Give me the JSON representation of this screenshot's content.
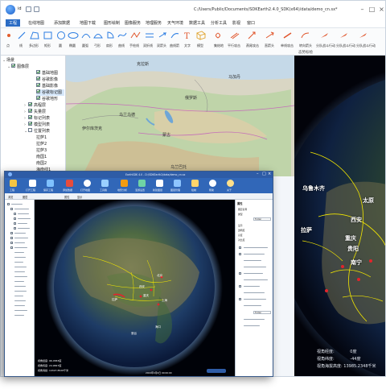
{
  "back_window": {
    "app_name": "id",
    "title": "C:/Users/Public/Documents/SDKEarth2.4.0_SDK(x64)/data/demo_cn.sx*",
    "menus": [
      "工程",
      "在线地图",
      "添加数据",
      "地图下载",
      "图形绘制",
      "图像服务",
      "地理服务",
      "天气环境",
      "数据工具",
      "分析工具",
      "影视",
      "窗口"
    ],
    "active_menu": "工程",
    "ribbon_tools": [
      "点",
      "线",
      "多边形",
      "矩形",
      "圆",
      "椭圆",
      "圆弧",
      "弓形",
      "扇形",
      "曲线",
      "手绘线",
      "双折线",
      "双箭头",
      "曲线箭",
      "文字",
      "模型"
    ],
    "ribbon_right_tools": [
      "集结地",
      "平行攻击",
      "燕尾攻击",
      "直箭头",
      "单线攻击",
      "转向箭头",
      "分队战斗行动",
      "分队战斗行动",
      "分队战斗行动"
    ],
    "ribbon_group_label": "态势标绘",
    "tree": {
      "root": "场景",
      "items": [
        {
          "label": "图像层",
          "checked": true,
          "level": 1,
          "expander": "⌄"
        },
        {
          "label": "基础地图",
          "checked": true,
          "level": 2
        },
        {
          "label": "谷歌影像",
          "checked": true,
          "level": 2
        },
        {
          "label": "基础影像",
          "checked": true,
          "level": 2
        },
        {
          "label": "谷歌标记图",
          "checked": true,
          "level": 2,
          "selected": true
        },
        {
          "label": "谷歌地形",
          "checked": true,
          "level": 2
        },
        {
          "label": "高程层",
          "checked": true,
          "level": 1,
          "expander": "›"
        },
        {
          "label": "矢量层",
          "checked": true,
          "level": 1,
          "expander": "›"
        },
        {
          "label": "标记列表",
          "checked": true,
          "level": 1,
          "expander": "›"
        },
        {
          "label": "模型列表",
          "checked": true,
          "level": 1,
          "expander": "›"
        },
        {
          "label": "位置列表",
          "checked": false,
          "level": 1,
          "expander": "⌄"
        },
        {
          "label": "拉萨1",
          "level": 2
        },
        {
          "label": "拉萨2",
          "level": 2
        },
        {
          "label": "拉萨3",
          "level": 2
        },
        {
          "label": "南国1",
          "level": 2
        },
        {
          "label": "南国2",
          "level": 2
        },
        {
          "label": "海南线1",
          "level": 2
        }
      ]
    },
    "map_labels": [
      "克拉斯",
      "马加丹",
      "俄罗斯",
      "乌兰乌德",
      "蒙古",
      "乌兰巴托",
      "伊尔库茨克"
    ],
    "globe_labels": [
      "乌鲁木齐",
      "太原",
      "西安",
      "重庆",
      "贵阳",
      "拉萨",
      "南宁"
    ],
    "status": {
      "lon_label": "视角经度:",
      "lon_value": "0度",
      "lat_label": "视角纬度:",
      "lat_value": "-44度",
      "alt_label": "视角海拔高度:",
      "alt_value": "13985.2348千米"
    }
  },
  "front_window": {
    "title": "EarthSDK 4.0 - D:/SDKEarth2/data/demo_cn.sx",
    "ribbon_buttons": [
      "工程",
      "打开工程",
      "保存工程",
      "添加数据",
      "打开地图",
      "工具箱",
      "地形分析",
      "漫游设置",
      "新建图层",
      "图层管理",
      "绘制",
      "帮助",
      "关于"
    ],
    "toolbar_items": [
      "浏览",
      "图层",
      "属性",
      "显示"
    ],
    "globe_labels": [
      "北京",
      "西安",
      "重庆",
      "上海",
      "拉萨",
      "海口",
      "曼谷"
    ],
    "status_lines": [
      "视角经度: 96.4583度",
      "视角纬度: 24.9847度",
      "视角海拔: 14327.8528千米"
    ],
    "bottom_text": "2024年0月0日 00:00:00",
    "props_header": "属性",
    "props_rows": [
      "图层名称",
      "类型",
      "Folder",
      "显示",
      "透明度",
      "亮度",
      "对比度",
      "Folder"
    ]
  },
  "colors": {
    "accent": "#2b6cc4",
    "front_ribbon": "#3167b8",
    "boundary": "#f2e600",
    "marker_red": "#e3242b"
  }
}
